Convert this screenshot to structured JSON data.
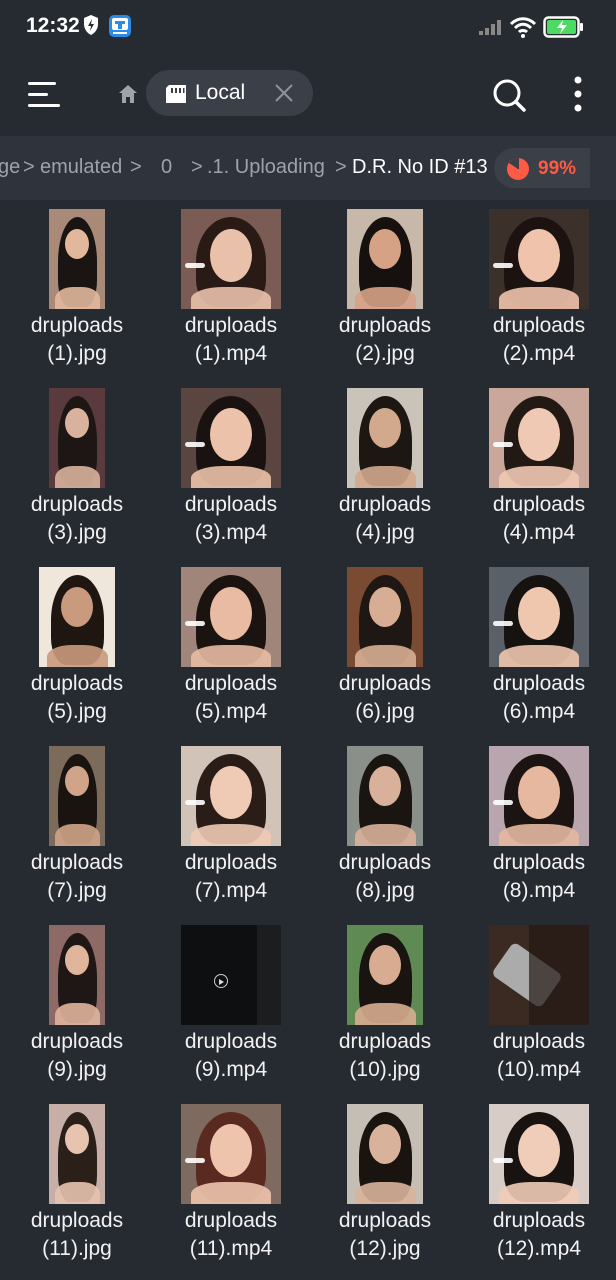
{
  "status_bar": {
    "time": "12:32",
    "icons": [
      "shield-icon",
      "app-notification-icon",
      "signal-icon",
      "wifi-icon",
      "battery-charging-icon"
    ]
  },
  "app_bar": {
    "menu_icon": "hamburger-menu-icon",
    "home_icon": "home-icon",
    "location_chip": {
      "label": "Local",
      "icon": "sd-card-icon",
      "close_icon": "close-icon"
    },
    "search_icon": "search-icon",
    "more_icon": "more-vertical-icon"
  },
  "breadcrumb": {
    "items": [
      "ge",
      "emulated",
      "0",
      ".1. Uploading",
      "D.R. No ID #13"
    ],
    "storage_usage": "99%",
    "colors": {
      "usage": "#ff5a44"
    }
  },
  "files": [
    {
      "line1": "druploads",
      "line2": "(1).jpg",
      "kind": "image",
      "bg": "#a98a78",
      "skin": "#e2b89c",
      "hairc": "#1a1412"
    },
    {
      "line1": "druploads",
      "line2": "(1).mp4",
      "kind": "video",
      "bg": "#7b5c54",
      "skin": "#e9c1ab",
      "hairc": "#2a1a15"
    },
    {
      "line1": "druploads",
      "line2": "(2).jpg",
      "kind": "image",
      "bg": "#c8b8aa",
      "skin": "#d6a286",
      "hairc": "#16110f"
    },
    {
      "line1": "druploads",
      "line2": "(2).mp4",
      "kind": "video",
      "bg": "#3c302b",
      "skin": "#efc3ac",
      "hairc": "#1c1310"
    },
    {
      "line1": "druploads",
      "line2": "(3).jpg",
      "kind": "image",
      "bg": "#5b3a3e",
      "skin": "#d8b29c",
      "hairc": "#1d1615"
    },
    {
      "line1": "druploads",
      "line2": "(3).mp4",
      "kind": "video",
      "bg": "#5a4540",
      "skin": "#ecc2aa",
      "hairc": "#1a1210"
    },
    {
      "line1": "druploads",
      "line2": "(4).jpg",
      "kind": "image",
      "bg": "#c9c3b9",
      "skin": "#d3a98d",
      "hairc": "#1d1713"
    },
    {
      "line1": "druploads",
      "line2": "(4).mp4",
      "kind": "video",
      "bg": "#c9a79a",
      "skin": "#f0c9b4",
      "hairc": "#221814"
    },
    {
      "line1": "druploads",
      "line2": "(5).jpg",
      "kind": "image",
      "bg": "#efe7dc",
      "skin": "#c99a7d",
      "hairc": "#1f1612"
    },
    {
      "line1": "druploads",
      "line2": "(5).mp4",
      "kind": "video",
      "bg": "#9f857a",
      "skin": "#e8bba2",
      "hairc": "#1b1310"
    },
    {
      "line1": "druploads",
      "line2": "(6).jpg",
      "kind": "image",
      "bg": "#7a4b33",
      "skin": "#d7ae93",
      "hairc": "#1f1713"
    },
    {
      "line1": "druploads",
      "line2": "(6).mp4",
      "kind": "video",
      "bg": "#596068",
      "skin": "#eec7ae",
      "hairc": "#161210"
    },
    {
      "line1": "druploads",
      "line2": "(7).jpg",
      "kind": "image",
      "bg": "#7c6b5b",
      "skin": "#cfa488",
      "hairc": "#1a1411"
    },
    {
      "line1": "druploads",
      "line2": "(7).mp4",
      "kind": "video",
      "bg": "#d1c3b8",
      "skin": "#efcbb5",
      "hairc": "#2a1d17"
    },
    {
      "line1": "druploads",
      "line2": "(8).jpg",
      "kind": "image",
      "bg": "#8a8f8a",
      "skin": "#d9b09a",
      "hairc": "#1b1512"
    },
    {
      "line1": "druploads",
      "line2": "(8).mp4",
      "kind": "video",
      "bg": "#b9a5ad",
      "skin": "#e6b8a0",
      "hairc": "#1c1412"
    },
    {
      "line1": "druploads",
      "line2": "(9).jpg",
      "kind": "image",
      "bg": "#8e6a66",
      "skin": "#e0b59c",
      "hairc": "#1f1715"
    },
    {
      "line1": "druploads",
      "line2": "(9).mp4",
      "kind": "video-dark",
      "bg": "#0e0f10",
      "skin": "",
      "hairc": ""
    },
    {
      "line1": "druploads",
      "line2": "(10).jpg",
      "kind": "image",
      "bg": "#5f8a54",
      "skin": "#d8ac90",
      "hairc": "#1a1411"
    },
    {
      "line1": "druploads",
      "line2": "(10).mp4",
      "kind": "video-dark",
      "bg": "#3a2a22",
      "skin": "",
      "hairc": ""
    },
    {
      "line1": "druploads",
      "line2": "(11).jpg",
      "kind": "image",
      "bg": "#c7aea6",
      "skin": "#e7c3b0",
      "hairc": "#2b1f1a"
    },
    {
      "line1": "druploads",
      "line2": "(11).mp4",
      "kind": "video",
      "bg": "#7f6a60",
      "skin": "#eec4ad",
      "hairc": "#5a2a20"
    },
    {
      "line1": "druploads",
      "line2": "(12).jpg",
      "kind": "image",
      "bg": "#c5beb4",
      "skin": "#d8b29b",
      "hairc": "#1a1411"
    },
    {
      "line1": "druploads",
      "line2": "(12).mp4",
      "kind": "video",
      "bg": "#d8cdc6",
      "skin": "#efcdb8",
      "hairc": "#181210"
    }
  ]
}
